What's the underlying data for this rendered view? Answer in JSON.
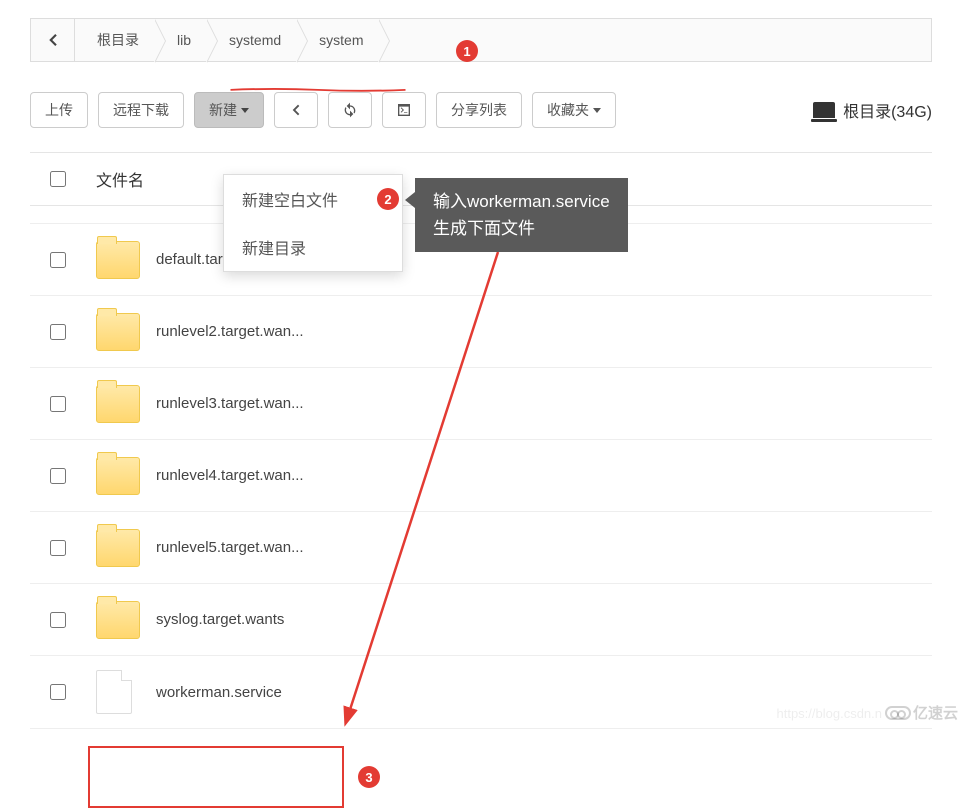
{
  "breadcrumb": {
    "items": [
      "根目录",
      "lib",
      "systemd",
      "system"
    ]
  },
  "toolbar": {
    "upload": "上传",
    "remote_download": "远程下载",
    "new": "新建",
    "share_list": "分享列表",
    "favorites": "收藏夹"
  },
  "dropdown": {
    "new_file": "新建空白文件",
    "new_folder": "新建目录"
  },
  "tooltip": {
    "line1": "输入workerman.service",
    "line2": "生成下面文件"
  },
  "disk": {
    "label": "根目录(34G)"
  },
  "table": {
    "header_name": "文件名"
  },
  "files": [
    {
      "name": "default.target.wants",
      "type": "folder"
    },
    {
      "name": "runlevel2.target.wan...",
      "type": "folder"
    },
    {
      "name": "runlevel3.target.wan...",
      "type": "folder"
    },
    {
      "name": "runlevel4.target.wan...",
      "type": "folder"
    },
    {
      "name": "runlevel5.target.wan...",
      "type": "folder"
    },
    {
      "name": "syslog.target.wants",
      "type": "folder"
    },
    {
      "name": "workerman.service",
      "type": "file"
    }
  ],
  "callouts": {
    "c1": "1",
    "c2": "2",
    "c3": "3"
  },
  "watermark": {
    "url": "https://blog.csdn.n",
    "logo": "亿速云"
  }
}
